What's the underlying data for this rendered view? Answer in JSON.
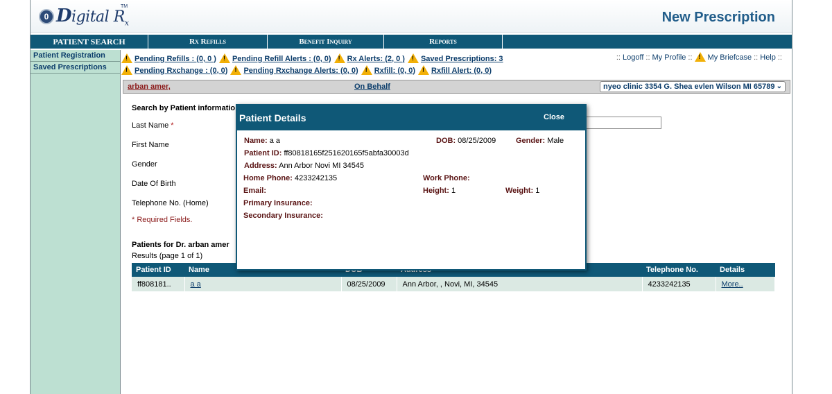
{
  "header": {
    "logo_letter": "0",
    "logo_text_big": "D",
    "logo_text_rest": "igital R",
    "logo_sub": "x",
    "logo_tm": "TM",
    "page_title": "New Prescription"
  },
  "nav": {
    "items": [
      "PATIENT SEARCH",
      "Rx Refills",
      "Benefit Inquiry",
      "Reports"
    ]
  },
  "sidebar": {
    "items": [
      "Patient Registration",
      "Saved Prescriptions"
    ]
  },
  "alerts": {
    "row1": [
      "Pending Refills : (0, 0 )",
      "Pending Refill Alerts : (0, 0)",
      "Rx Alerts: (2, 0 )",
      "Saved Prescriptions: 3"
    ],
    "row2": [
      "Pending Rxchange : (0, 0)",
      "Pending Rxchange Alerts: (0, 0)",
      "Rxfill: (0, 0)",
      "Rxfill Alert: (0, 0)"
    ],
    "links": {
      "logoff": "Logoff",
      "profile": "My Profile",
      "briefcase": "My Briefcase",
      "help": "Help",
      "sep": "::"
    }
  },
  "onbehalf": {
    "user": "arban amer,",
    "label": "On Behalf",
    "clinic": "nyeo clinic 3354 G. Shea evlen Wilson MI 65789"
  },
  "search_form": {
    "heading": "Search by Patient informatio",
    "last_name": "Last Name",
    "req_mark": "*",
    "first_name": "First Name",
    "gender": "Gender",
    "dob": "Date Of Birth",
    "telephone": "Telephone No. (Home)",
    "required_note": "* Required Fields."
  },
  "patients": {
    "heading": "Patients for Dr. arban amer",
    "results": "Results (page 1 of 1)",
    "columns": [
      "Patient ID",
      "Name",
      "DOB",
      "Address",
      "Telephone No.",
      "Details"
    ],
    "rows": [
      {
        "id": "ff808181..",
        "name": "a a",
        "dob": "08/25/2009",
        "address": "Ann Arbor, , Novi, MI, 34545",
        "phone": "4233242135",
        "details": "More.."
      }
    ]
  },
  "modal": {
    "title": "Patient Details",
    "close": "Close",
    "name_label": "Name:",
    "name": "a a",
    "dob_label": "DOB:",
    "dob": "08/25/2009",
    "gender_label": "Gender:",
    "gender": "Male",
    "pid_label": "Patient ID:",
    "pid": "ff80818165f251620165f5abfa30003d",
    "address_label": "Address:",
    "address": "Ann Arbor Novi MI 34545",
    "home_phone_label": "Home Phone:",
    "home_phone": "4233242135",
    "work_phone_label": "Work Phone:",
    "email_label": "Email:",
    "height_label": "Height:",
    "height": "1",
    "weight_label": "Weight:",
    "weight": "1",
    "primary_label": "Primary Insurance:",
    "secondary_label": "Secondary Insurance:"
  }
}
